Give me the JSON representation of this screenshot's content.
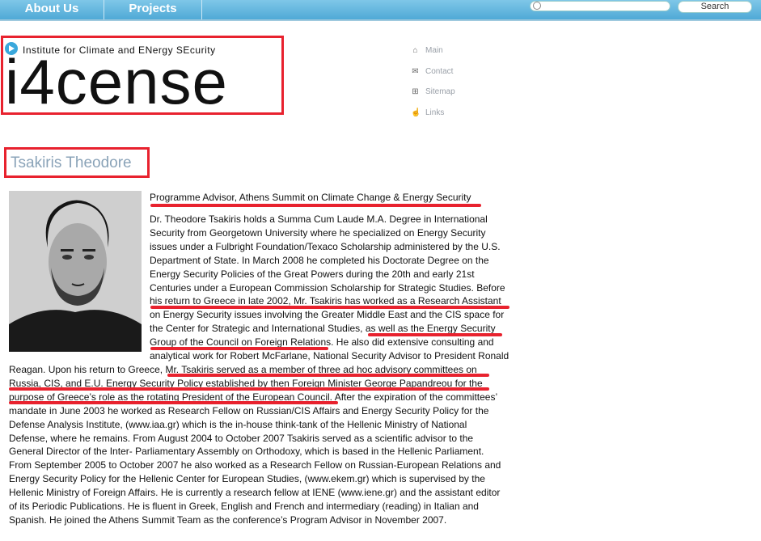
{
  "nav": {
    "about_label": "About Us",
    "projects_label": "Projects"
  },
  "search": {
    "placeholder": "",
    "button_label": "Search"
  },
  "logo": {
    "tagline": "Institute for Climate and ENergy SEcurity",
    "wordmark": "i4cense"
  },
  "side_menu": [
    {
      "label": "Main",
      "icon": "home-icon"
    },
    {
      "label": "Contact",
      "icon": "mail-icon"
    },
    {
      "label": "Sitemap",
      "icon": "sitemap-icon"
    },
    {
      "label": "Links",
      "icon": "hand-icon"
    }
  ],
  "person": {
    "name": "Tsakiris Theodore",
    "role": "Programme Advisor, Athens Summit on Climate Change & Energy Security",
    "bio_right": [
      "Dr. Theodore Tsakiris holds a Summa Cum Laude M.A. Degree in International",
      "Security from Georgetown University where he specialized on Energy Security",
      "issues under a Fulbright Foundation/Texaco Scholarship administered by the U.S.",
      "Department of State. In March 2008 he completed his Doctorate Degree on the",
      "Energy Security Policies of the Great Powers during the 20th and early 21st",
      "Centuries under a European Commission Scholarship for Strategic Studies. Before",
      "his return to Greece in late 2002, Mr. Tsakiris has worked as a Research Assistant",
      "on Energy Security issues involving the Greater Middle East and the CIS space for",
      "the Center for Strategic and International Studies, as well as the Energy Security",
      "Group of the Council on Foreign Relations. He also did extensive consulting and",
      "analytical work for Robert McFarlane, National Security Advisor to President Ronald"
    ],
    "bio_full": [
      "Reagan. Upon his return to Greece, Mr. Tsakiris served as a member of three ad hoc advisory committees on",
      "Russia, CIS, and E.U. Energy Security Policy established by then Foreign Minister George Papandreou for the",
      "purpose of Greece’s role as the rotating President of the European Council. After the expiration of the committees’",
      "mandate in June 2003 he worked as Research Fellow on Russian/CIS Affairs and Energy Security Policy for the",
      "Defense Analysis Institute, (www.iaa.gr) which is the in-house think-tank of the Hellenic Ministry of National",
      "Defense, where he remains. From August 2004 to October 2007 Tsakiris served as a scientific advisor to the",
      "General Director of the Inter- Parliamentary Assembly on Orthodoxy, which is based in the Hellenic Parliament.",
      "From September 2005 to October 2007 he also worked as a Research Fellow on Russian-European Relations and",
      "Energy Security Policy for the Hellenic Center for European Studies, (www.ekem.gr) which is supervised by the",
      "Hellenic Ministry of Foreign Affairs. He is currently a research fellow at IENE (www.iene.gr) and the assistant editor",
      "of its Periodic Publications. He is fluent in Greek, English and French and intermediary (reading) in Italian and",
      "Spanish. He joined the Athens Summit Team as the conference’s Program Advisor in November 2007."
    ]
  },
  "colors": {
    "nav": "#5fb4de",
    "highlight": "#e8222e",
    "name": "#8aa3b8",
    "menu_text": "#9aa0a8"
  }
}
